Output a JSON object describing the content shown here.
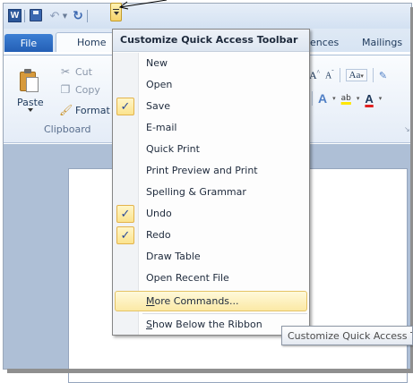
{
  "qat": {
    "app_icon_letter": "W",
    "customize_tooltip": "Customize Quick Access Toolbar"
  },
  "tabs": {
    "file": "File",
    "home": "Home",
    "references_partial": "ences",
    "mailings": "Mailings"
  },
  "ribbon": {
    "paste": "Paste",
    "cut": "Cut",
    "copy": "Copy",
    "format_painter": "Format",
    "clipboard_group": "Clipboard",
    "grow_font": "A",
    "shrink_font": "A",
    "change_case": "Aa",
    "highlight": "ab",
    "font_color": "A"
  },
  "menu": {
    "title": "Customize Quick Access Toolbar",
    "items": [
      {
        "label": "New",
        "checked": false
      },
      {
        "label": "Open",
        "checked": false
      },
      {
        "label": "Save",
        "checked": true
      },
      {
        "label": "E-mail",
        "checked": false
      },
      {
        "label": "Quick Print",
        "checked": false
      },
      {
        "label": "Print Preview and Print",
        "checked": false
      },
      {
        "label": "Spelling & Grammar",
        "checked": false
      },
      {
        "label": "Undo",
        "checked": true
      },
      {
        "label": "Redo",
        "checked": true
      },
      {
        "label": "Draw Table",
        "checked": false
      },
      {
        "label": "Open Recent File",
        "checked": false
      }
    ],
    "more_commands": {
      "mnemonic": "M",
      "rest": "ore Commands..."
    },
    "show_below": {
      "mnemonic": "S",
      "rest": "how Below the Ribbon"
    }
  },
  "tooltip": "Customize Quick Access Toolbar"
}
